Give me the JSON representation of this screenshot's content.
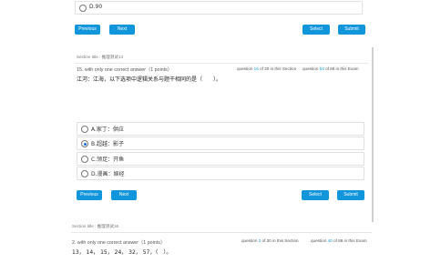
{
  "prev_block": {
    "option_d": "D.90"
  },
  "buttons": {
    "previous": "Previous",
    "next": "Next",
    "select": "Select",
    "submit": "Submit"
  },
  "current_question": {
    "section_title": "Section title : 推理测试14",
    "header": "15. with only one correct answer（1 points）",
    "progress": {
      "prefix": "question",
      "section_current": "15",
      "section_middle": "of 30 in this Section",
      "exam_prefix": "question",
      "exam_current": "53",
      "exam_suffix": "of 88 in this Exam"
    },
    "text": "江河：江海，以下选项中逻辑关系与题干相同的是（　　）。",
    "options": [
      {
        "label": "A.家丁：供应",
        "selected": false
      },
      {
        "label": "B.超越：影子",
        "selected": true
      },
      {
        "label": "C.领足：开鱼",
        "selected": false
      },
      {
        "label": "D.漫画：娱经",
        "selected": false
      }
    ]
  },
  "next_question": {
    "section_title": "Section title : 推理测试16",
    "header": "2. with only one correct answer（1 points）",
    "progress": {
      "prefix": "question",
      "section_current": "2",
      "section_middle": "of 30 in this Section",
      "exam_prefix": "question",
      "exam_current": "40",
      "exam_suffix": "of 88 in this Exam"
    },
    "text": "13， 14， 15， 24， 32， 57，（　）。"
  },
  "colors": {
    "accent": "#1296db",
    "highlight_number": "#1296db"
  }
}
